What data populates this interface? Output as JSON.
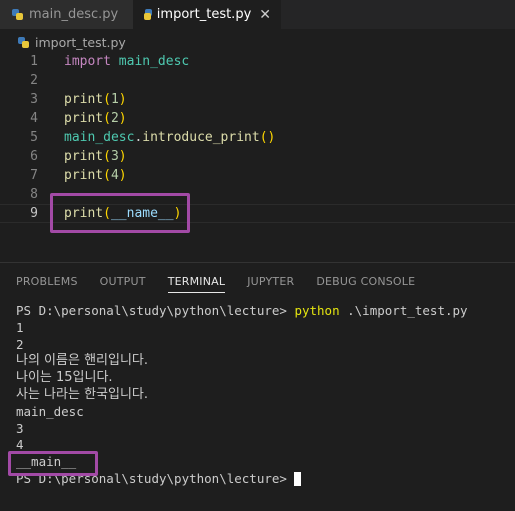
{
  "tabs": [
    {
      "label": "main_desc.py"
    },
    {
      "label": "import_test.py",
      "close": "✕"
    }
  ],
  "breadcrumb": "import_test.py",
  "editor": {
    "line_numbers": [
      "1",
      "2",
      "3",
      "4",
      "5",
      "6",
      "7",
      "8",
      "9"
    ],
    "lines": {
      "l1_kw": "import",
      "l1_mod": " main_desc",
      "l3_fn": "print",
      "l3_open": "(",
      "l3_num": "1",
      "l3_close": ")",
      "l4_fn": "print",
      "l4_open": "(",
      "l4_num": "2",
      "l4_close": ")",
      "l5_mod": "main_desc",
      "l5_dot": ".",
      "l5_fn": "introduce_print",
      "l5_paren": "()",
      "l6_fn": "print",
      "l6_open": "(",
      "l6_num": "3",
      "l6_close": ")",
      "l7_fn": "print",
      "l7_open": "(",
      "l7_num": "4",
      "l7_close": ")",
      "l9_fn": "print",
      "l9_open": "(",
      "l9_var": "__name__",
      "l9_close": ")"
    }
  },
  "panel": {
    "tabs": [
      "PROBLEMS",
      "OUTPUT",
      "TERMINAL",
      "JUPYTER",
      "DEBUG CONSOLE"
    ],
    "active_tab": "TERMINAL"
  },
  "terminal": {
    "prompt": "PS D:\\personal\\study\\python\\lecture> ",
    "command": "python",
    "command_arg": " .\\import_test.py",
    "output": [
      "1",
      "2",
      "나의 이름은 핸리입니다.",
      "나이는 15입니다.",
      "사는 나라는 한국입니다.",
      "main_desc",
      "3",
      "4",
      "__main__"
    ],
    "final_prompt": "PS D:\\personal\\study\\python\\lecture>"
  },
  "colors": {
    "highlight_box": "#a24aa6",
    "editor_bg": "#1e1e1e",
    "keyword": "#c586c0",
    "function": "#dcdcaa",
    "module": "#4ec9b0"
  }
}
